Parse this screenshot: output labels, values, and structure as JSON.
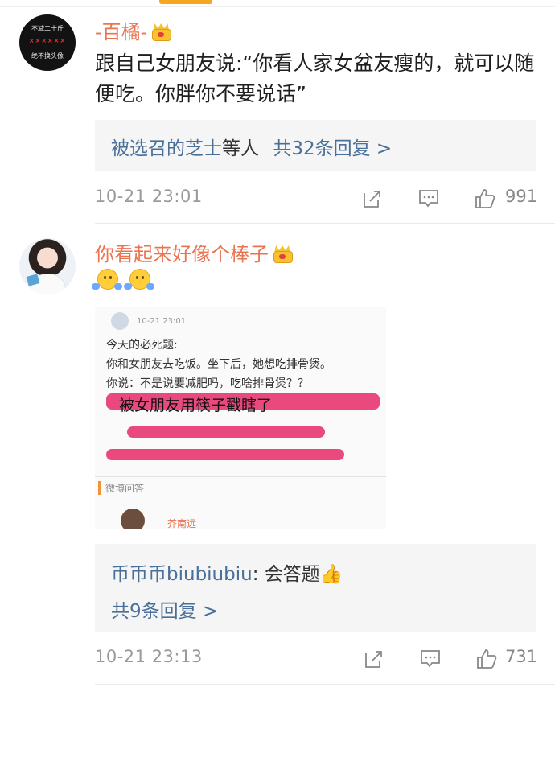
{
  "comments": [
    {
      "username": "-百橘-",
      "avatar_text": [
        "不减二十斤",
        "××××××",
        "绝不换头像"
      ],
      "text": "跟自己女朋友说:“你看人家女盆友瘦的，就可以随便吃。你胖你不要说话”",
      "reply_summary": {
        "names": "被选召的芝士",
        "suffix": "等人",
        "count_label": "共32条回复 >"
      },
      "time": "10-21 23:01",
      "likes": "991"
    },
    {
      "username": "你看起来好像个棒子",
      "emoji_count": 2,
      "screenshot": {
        "time": "10-21 23:01",
        "line1": "今天的必死题:",
        "line2": "你和女朋友去吃饭。坐下后，她想吃排骨煲。",
        "line3": "你说：不是说要减肥吗，吃啥排骨煲？？",
        "overlay": "被女朋友用筷子戳瞎了",
        "section": "微博问答",
        "name": "芥南远"
      },
      "reply_preview": {
        "name": "币币币biubiubiu",
        "text": ": 会答题👍"
      },
      "reply_count_label": "共9条回复 >",
      "time": "10-21 23:13",
      "likes": "731"
    }
  ],
  "icons": {
    "share": "share-icon",
    "comment": "comment-icon",
    "like": "thumbs-up-icon",
    "crown": "crown-icon"
  },
  "colors": {
    "username": "#eb7350",
    "link": "#4a6f99",
    "top_indicator": "#f5a623"
  }
}
